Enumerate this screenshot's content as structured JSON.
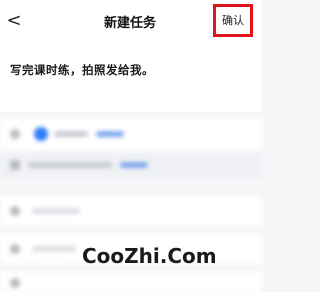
{
  "header": {
    "back_icon": "chevron-left-icon",
    "back_glyph": "<",
    "title": "新建任务",
    "confirm_label": "确认",
    "confirm_highlight_color": "#e0151c"
  },
  "task": {
    "text": "写完课时练，拍照发给我。"
  },
  "watermark": {
    "text": "CooZhi.Com"
  }
}
